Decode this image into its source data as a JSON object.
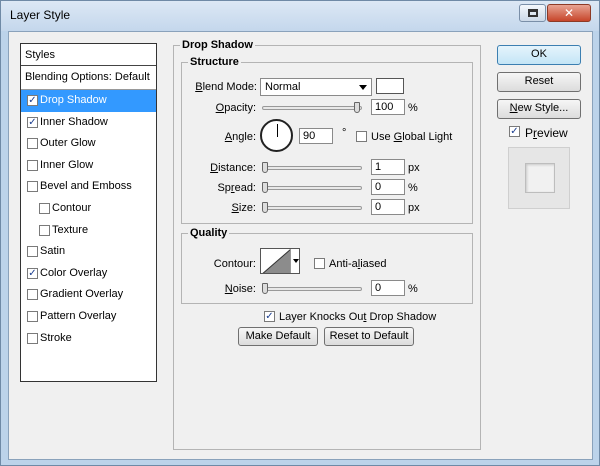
{
  "window": {
    "title": "Layer Style"
  },
  "styles_panel": {
    "header": "Styles",
    "blending_options": "Blending Options: Default",
    "items": [
      {
        "label": "Drop Shadow",
        "checked": true,
        "selected": true,
        "sub": false
      },
      {
        "label": "Inner Shadow",
        "checked": true,
        "selected": false,
        "sub": false
      },
      {
        "label": "Outer Glow",
        "checked": false,
        "selected": false,
        "sub": false
      },
      {
        "label": "Inner Glow",
        "checked": false,
        "selected": false,
        "sub": false
      },
      {
        "label": "Bevel and Emboss",
        "checked": false,
        "selected": false,
        "sub": false
      },
      {
        "label": "Contour",
        "checked": false,
        "selected": false,
        "sub": true
      },
      {
        "label": "Texture",
        "checked": false,
        "selected": false,
        "sub": true
      },
      {
        "label": "Satin",
        "checked": false,
        "selected": false,
        "sub": false
      },
      {
        "label": "Color Overlay",
        "checked": true,
        "selected": false,
        "sub": false
      },
      {
        "label": "Gradient Overlay",
        "checked": false,
        "selected": false,
        "sub": false
      },
      {
        "label": "Pattern Overlay",
        "checked": false,
        "selected": false,
        "sub": false
      },
      {
        "label": "Stroke",
        "checked": false,
        "selected": false,
        "sub": false
      }
    ]
  },
  "drop_shadow": {
    "group_title": "Drop Shadow",
    "structure": {
      "title": "Structure",
      "blend_mode_label": "Blend Mode:",
      "blend_mode_value": "Normal",
      "shadow_color": "#ffffff",
      "opacity_label": "Opacity:",
      "opacity_value": "100",
      "opacity_unit": "%",
      "opacity_fraction": 1.0,
      "angle_label": "Angle:",
      "angle_value": "90",
      "angle_unit": "°",
      "use_global_light_label": "Use Global Light",
      "use_global_light_checked": false,
      "distance_label": "Distance:",
      "distance_value": "1",
      "distance_unit": "px",
      "distance_fraction": 0.0,
      "spread_label": "Spread:",
      "spread_value": "0",
      "spread_unit": "%",
      "spread_fraction": 0.0,
      "size_label": "Size:",
      "size_value": "0",
      "size_unit": "px",
      "size_fraction": 0.0
    },
    "quality": {
      "title": "Quality",
      "contour_label": "Contour:",
      "anti_aliased_label": "Anti-aliased",
      "anti_aliased_checked": false,
      "noise_label": "Noise:",
      "noise_value": "0",
      "noise_unit": "%",
      "noise_fraction": 0.0
    },
    "knocks_out_label": "Layer Knocks Out Drop Shadow",
    "knocks_out_checked": true,
    "make_default_label": "Make Default",
    "reset_default_label": "Reset to Default"
  },
  "actions": {
    "ok_label": "OK",
    "reset_label": "Reset",
    "new_style_label": "New Style...",
    "preview_label": "Preview",
    "preview_checked": true
  }
}
